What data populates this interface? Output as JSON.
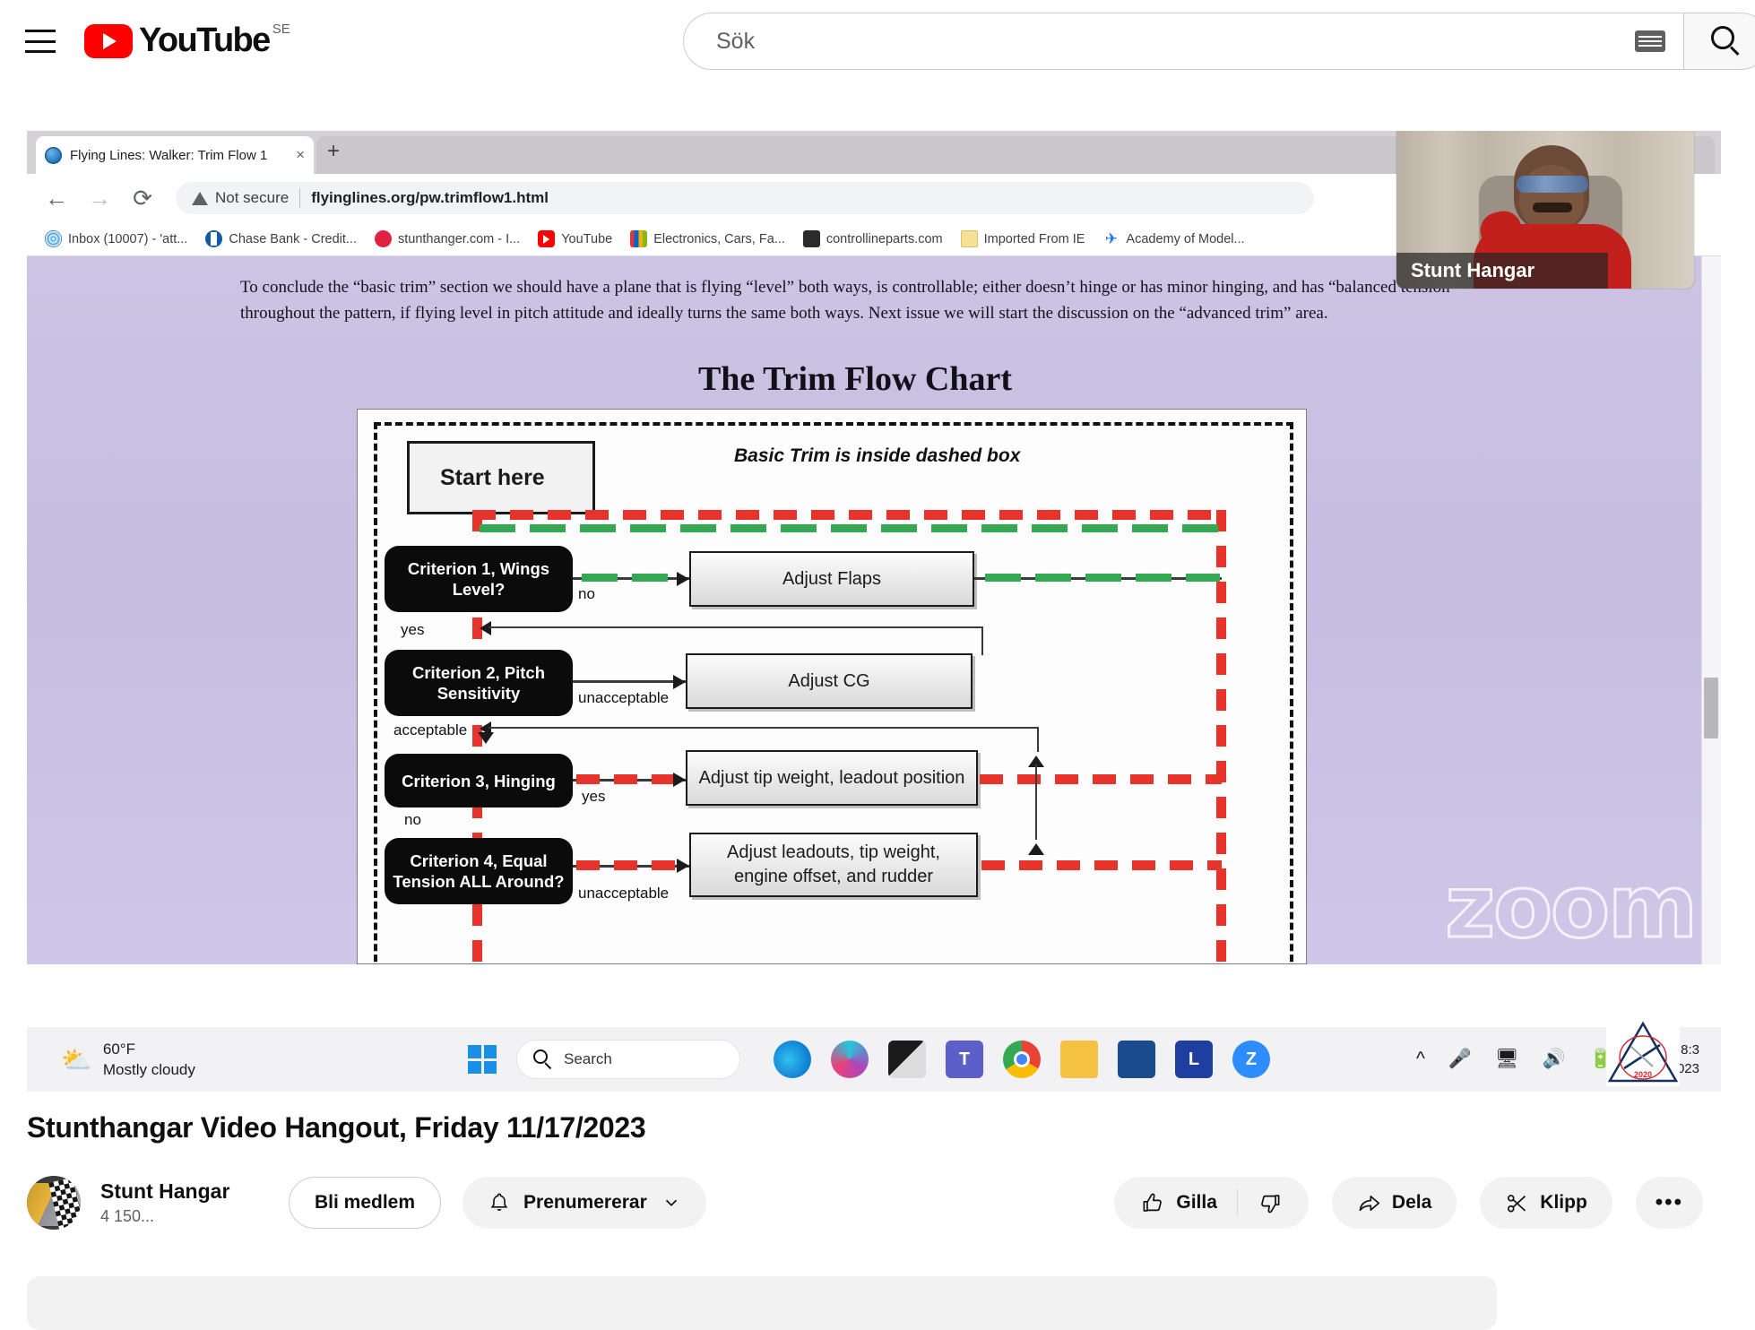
{
  "header": {
    "menu_icon": "hamburger-menu-icon",
    "logo_text": "YouTube",
    "country_code": "SE",
    "search": {
      "placeholder": "Sök",
      "value": "",
      "keyboard_icon": "keyboard-icon",
      "search_icon": "search-icon"
    }
  },
  "player": {
    "browser": {
      "tab": {
        "title": "Flying Lines: Walker: Trim Flow 1",
        "close_label": "×",
        "new_tab_label": "+",
        "favicon": "globe-icon"
      },
      "nav": {
        "back": "←",
        "forward": "→",
        "reload": "⟳"
      },
      "address": {
        "security_label": "Not secure",
        "url": "flyinglines.org/pw.trimflow1.html",
        "warning_icon": "warning-triangle-icon"
      },
      "bookmarks": [
        {
          "label": "Inbox (10007) - 'att...",
          "icon": "att-icon",
          "color": "#2ea3dd"
        },
        {
          "label": "Chase Bank - Credit...",
          "icon": "chase-icon",
          "color": "#1259a6"
        },
        {
          "label": "stunthanger.com - I...",
          "icon": "stunthanger-icon",
          "color": "#e0213f"
        },
        {
          "label": "YouTube",
          "icon": "youtube-icon",
          "color": "#ff0000"
        },
        {
          "label": "Electronics, Cars, Fa...",
          "icon": "ebay-bag-icon",
          "color": "#f0b429"
        },
        {
          "label": "controllineparts.com",
          "icon": "engine-icon",
          "color": "#2b2b2b"
        },
        {
          "label": "Imported From IE",
          "icon": "folder-icon",
          "color": "#f7df94"
        },
        {
          "label": "Academy of Model...",
          "icon": "airplane-icon",
          "color": "#1a73e8"
        }
      ]
    },
    "page": {
      "body_text": "To conclude the “basic trim” section we should have a plane that is flying “level” both ways, is controllable; either doesn’t hinge or has minor hinging, and has “balanced tension throughout the pattern, if flying level in pitch attitude and ideally turns the same both ways. Next issue we will start the discussion on the “advanced trim” area.",
      "heading": "The Trim Flow Chart",
      "flowchart": {
        "note": "Basic Trim is inside dashed box",
        "start_label": "Start here",
        "decisions": [
          {
            "label": "Criterion 1, Wings Level?",
            "out_label": "no",
            "down_label": "yes"
          },
          {
            "label": "Criterion 2, Pitch Sensitivity",
            "out_label": "unacceptable",
            "down_label": "acceptable"
          },
          {
            "label": "Criterion 3, Hinging",
            "out_label": "yes",
            "down_label": "no"
          },
          {
            "label": "Criterion 4, Equal Tension ALL Around?",
            "out_label": "unacceptable",
            "down_label": ""
          }
        ],
        "actions": [
          "Adjust Flaps",
          "Adjust CG",
          "Adjust tip weight,  leadout position",
          "Adjust leadouts, tip weight, engine offset, and rudder"
        ]
      },
      "watermark": "zoom"
    },
    "presenter": {
      "name": "Stunt Hangar"
    },
    "taskbar": {
      "weather_temp": "60°F",
      "weather_desc": "Mostly cloudy",
      "weather_icon": "partly-cloudy-icon",
      "start_icon": "windows-start-icon",
      "search_placeholder": "Search",
      "apps": [
        {
          "name": "edge-icon"
        },
        {
          "name": "copilot-pre-icon"
        },
        {
          "name": "excel-icon"
        },
        {
          "name": "teams-icon"
        },
        {
          "name": "chrome-icon"
        },
        {
          "name": "file-explorer-icon"
        },
        {
          "name": "microsoft-store-icon"
        },
        {
          "name": "logitech-icon"
        },
        {
          "name": "zoom-icon"
        }
      ],
      "tray": {
        "chevron": "show-hidden-icons",
        "mic": "microphone-icon",
        "display": "display-icon",
        "volume": "volume-icon",
        "battery": "battery-icon"
      },
      "clock_time": "8:3",
      "clock_date": "11/17/2023"
    }
  },
  "video": {
    "title": "Stunthangar Video Hangout, Friday 11/17/2023",
    "channel": {
      "name": "Stunt Hangar",
      "subscribers": "4 150..."
    },
    "join_button": "Bli medlem",
    "subscribe_button": "Prenumererar",
    "actions": {
      "like": "Gilla",
      "dislike": "",
      "share": "Dela",
      "clip": "Klipp",
      "more": "•••"
    }
  }
}
